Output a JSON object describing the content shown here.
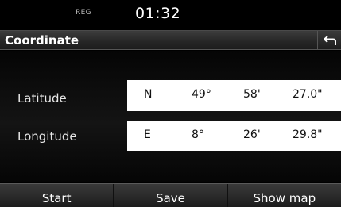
{
  "status": {
    "label": "REG",
    "clock": "01:32"
  },
  "header": {
    "title": "Coordinate"
  },
  "coordinates": {
    "latitude": {
      "label": "Latitude",
      "direction": "N",
      "degrees": "49°",
      "minutes": "58'",
      "seconds": "27.0\""
    },
    "longitude": {
      "label": "Longitude",
      "direction": "E",
      "degrees": "8°",
      "minutes": "26'",
      "seconds": "29.8\""
    }
  },
  "footer": {
    "start_label": "Start",
    "save_label": "Save",
    "showmap_label": "Show map"
  },
  "icons": {
    "back": "back-arrow-icon"
  }
}
